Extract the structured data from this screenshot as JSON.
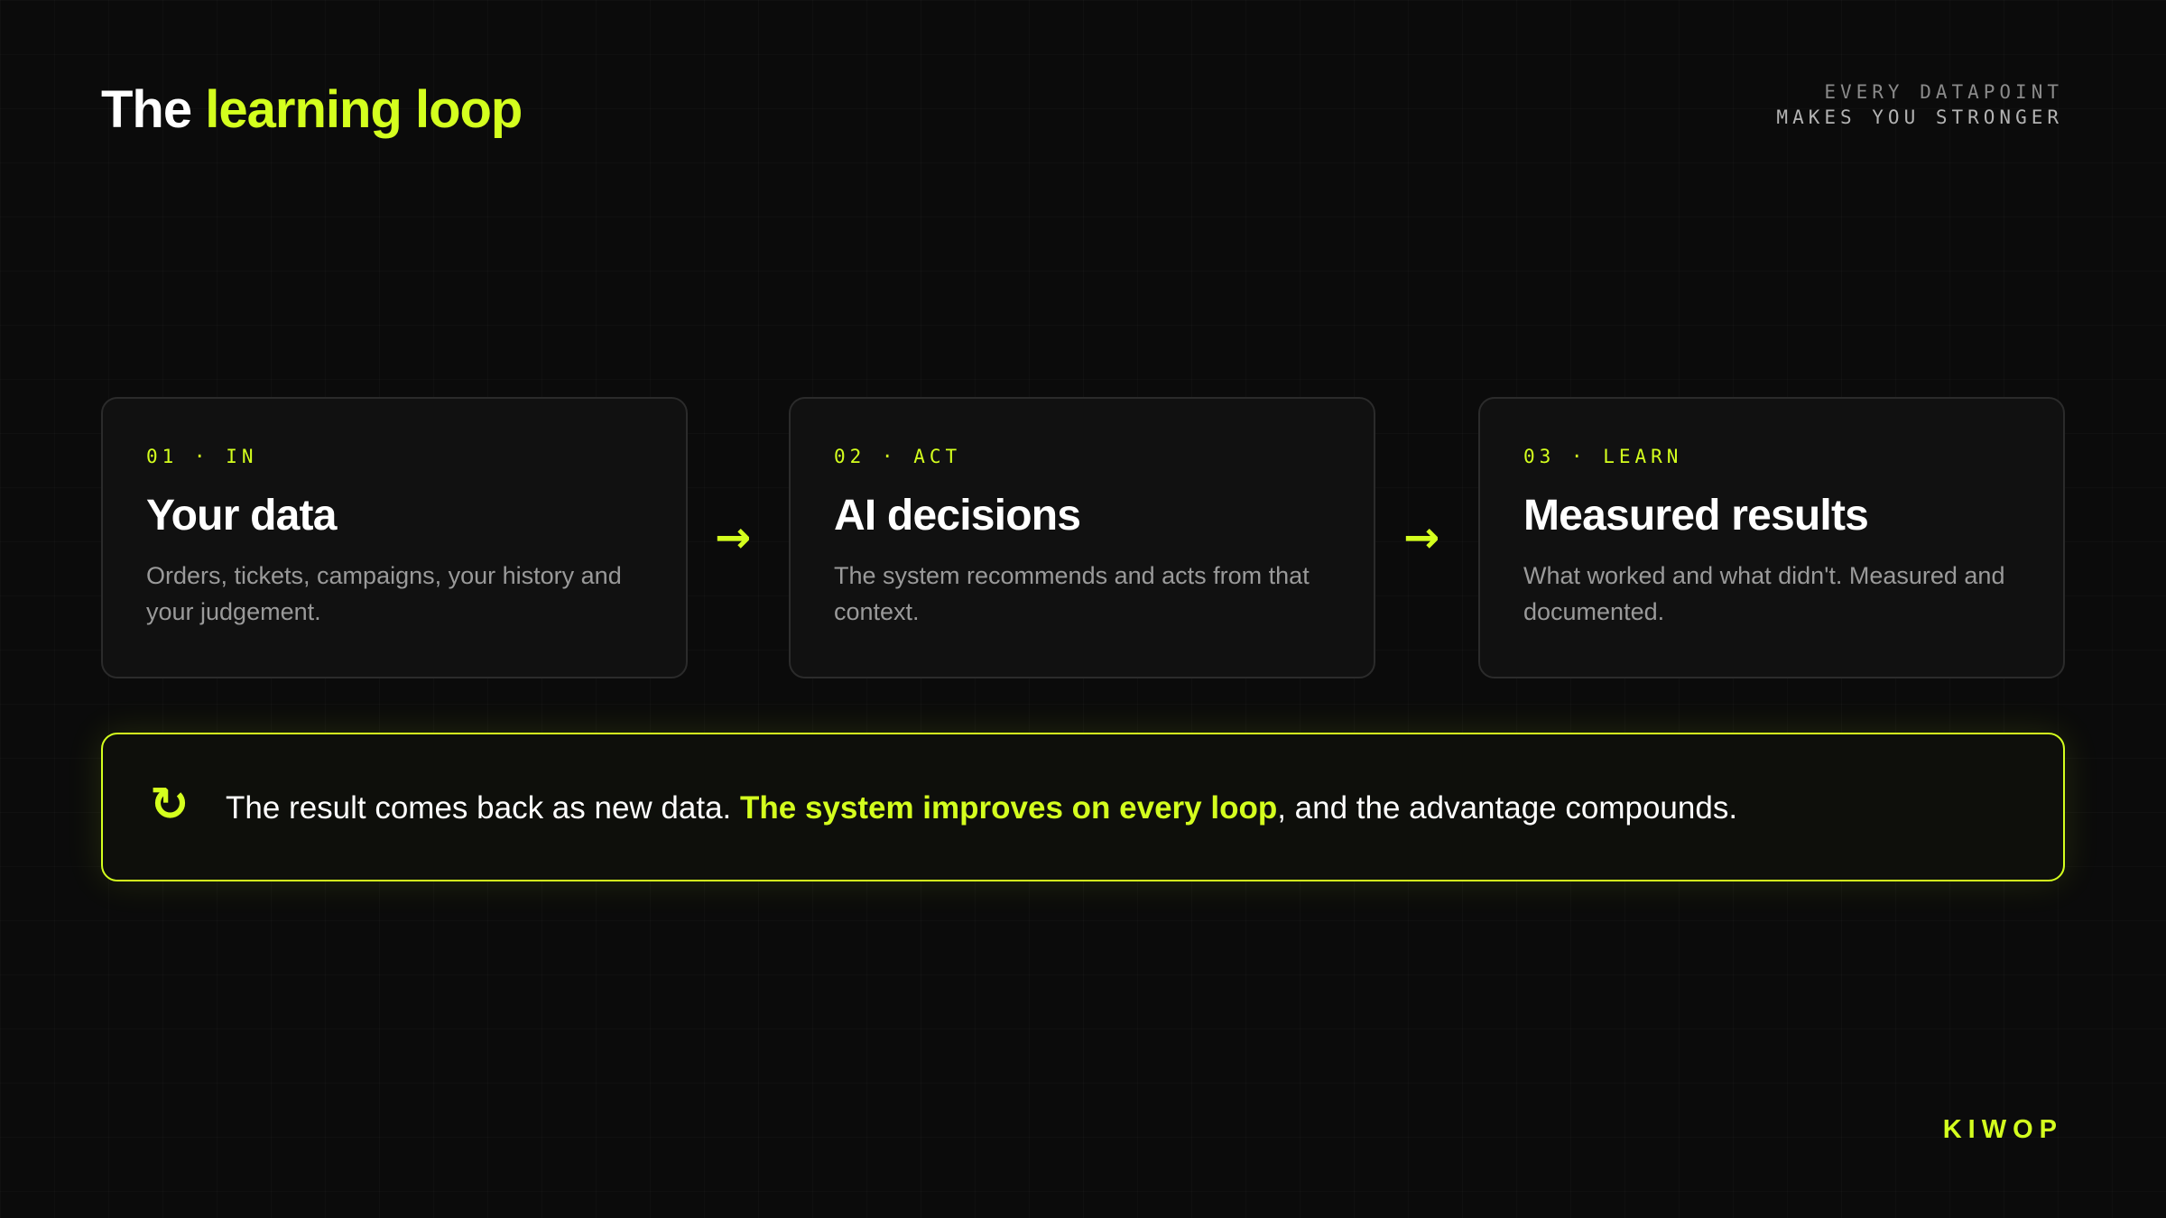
{
  "header": {
    "title_prefix": "The",
    "title_accent": "learning loop",
    "tagline_line1": "EVERY DATAPOINT",
    "tagline_line2": "MAKES YOU STRONGER"
  },
  "steps": [
    {
      "label": "01 · IN",
      "heading": "Your data",
      "description": "Orders, tickets, campaigns, your history and your judgement."
    },
    {
      "label": "02 · ACT",
      "heading": "AI decisions",
      "description": "The system recommends and acts from that context."
    },
    {
      "label": "03 · LEARN",
      "heading": "Measured results",
      "description": "What worked and what didn't. Measured and documented."
    }
  ],
  "connectors": [
    "→",
    "→"
  ],
  "banner": {
    "icon": "refresh-loop-icon",
    "icon_glyph": "↻",
    "text_before": "The result comes back as new data. ",
    "text_highlight": "The system improves on every loop",
    "text_after": ", and the advantage compounds."
  },
  "brand": "KIWOP",
  "colors": {
    "background": "#0b0b0b",
    "accent": "#d4ff1e",
    "card": "#111111",
    "card_border": "#2b2b2b",
    "muted_text": "#9a9a9a"
  }
}
